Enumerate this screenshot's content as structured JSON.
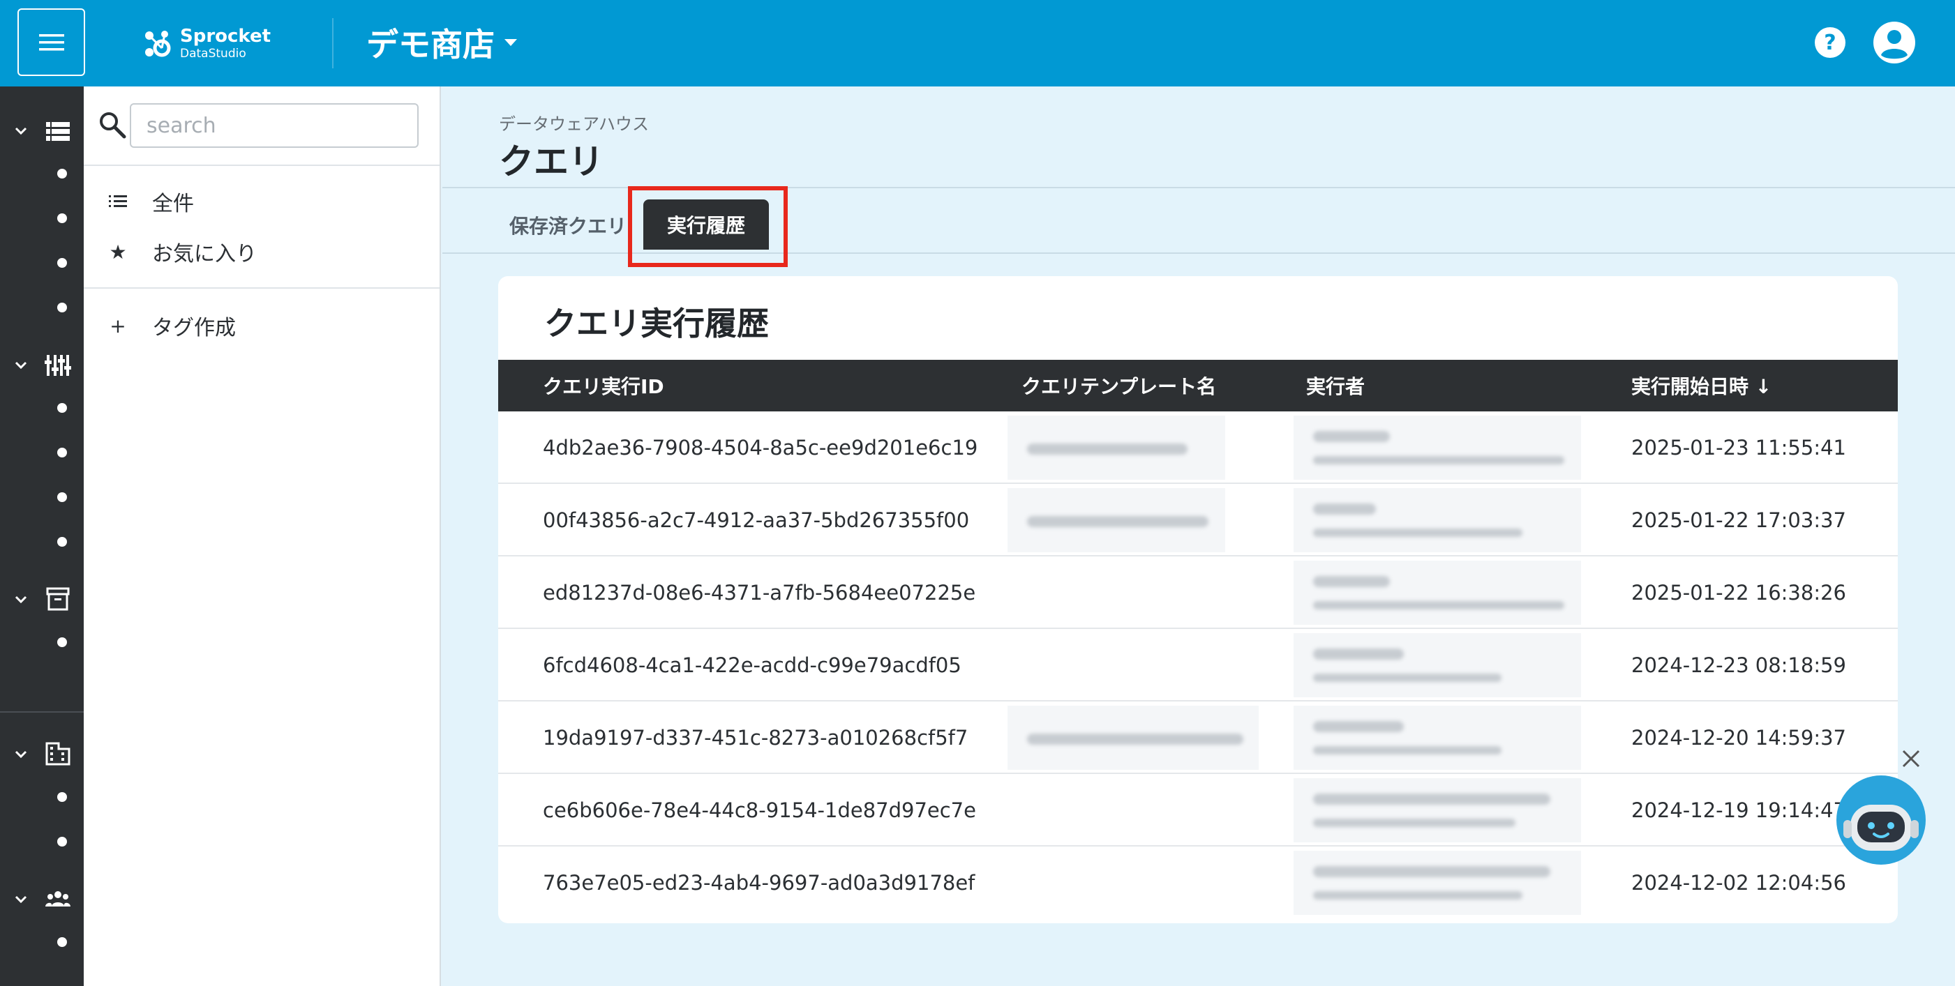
{
  "header": {
    "logo_name": "Sprocket",
    "logo_sub": "DataStudio",
    "shop_name": "デモ商店"
  },
  "sidebar": {
    "search_placeholder": "search",
    "items": [
      {
        "icon": "list-icon",
        "label": "全件"
      },
      {
        "icon": "star-icon",
        "label": "お気に入り"
      },
      {
        "icon": "plus-icon",
        "label": "タグ作成"
      }
    ]
  },
  "main": {
    "breadcrumb": "データウェアハウス",
    "title": "クエリ",
    "tabs": [
      {
        "label": "保存済クエリ",
        "active": false
      },
      {
        "label": "実行履歴",
        "active": true
      }
    ]
  },
  "table": {
    "title": "クエリ実行履歴",
    "columns": [
      "クエリ実行ID",
      "クエリテンプレート名",
      "実行者",
      "実行開始日時 ↓"
    ],
    "rows": [
      {
        "id": "4db2ae36-7908-4504-8a5c-ee9d201e6c19",
        "started": "2025-01-23 11:55:41"
      },
      {
        "id": "00f43856-a2c7-4912-aa37-5bd267355f00",
        "started": "2025-01-22 17:03:37"
      },
      {
        "id": "ed81237d-08e6-4371-a7fb-5684ee07225e",
        "started": "2025-01-22 16:38:26"
      },
      {
        "id": "6fcd4608-4ca1-422e-acdd-c99e79acdf05",
        "started": "2024-12-23 08:18:59"
      },
      {
        "id": "19da9197-d337-451c-8273-a010268cf5f7",
        "started": "2024-12-20 14:59:37"
      },
      {
        "id": "ce6b606e-78e4-44c8-9154-1de87d97ec7e",
        "started": "2024-12-19 19:14:47"
      },
      {
        "id": "763e7e05-ed23-4ab4-9697-ad0a3d9178ef",
        "started": "2024-12-02 12:04:56"
      }
    ]
  },
  "colors": {
    "topbar": "#0199d3",
    "rail": "#2d3033",
    "highlight": "#e8281c",
    "page_bg": "#e3f3fb"
  }
}
